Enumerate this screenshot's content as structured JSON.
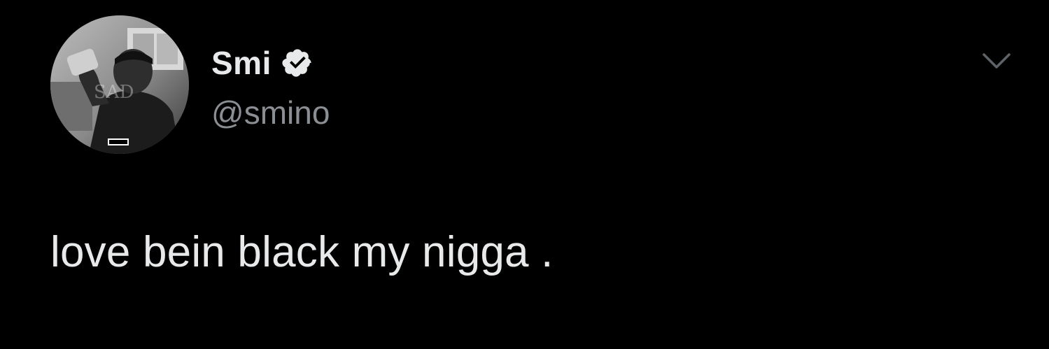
{
  "tweet": {
    "author": {
      "display_name": "Smi",
      "handle": "@smino",
      "verified": true,
      "avatar_icon": "profile-photo"
    },
    "text": "love bein black my nigga .",
    "menu_icon": "chevron-down-icon"
  },
  "colors": {
    "background": "#000000",
    "primary_text": "#e7e9ea",
    "secondary_text": "#8b8f94",
    "badge": "#e7e9ea"
  }
}
